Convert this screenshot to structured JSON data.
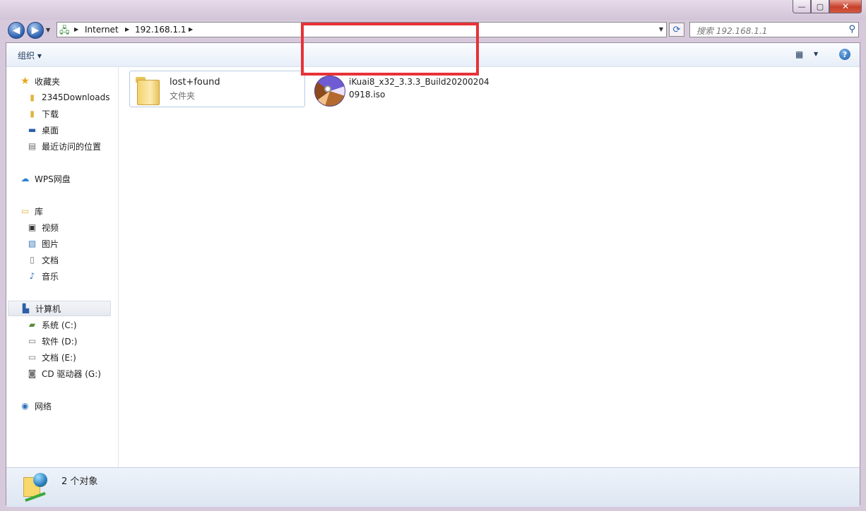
{
  "window": {
    "title": "",
    "controls": {
      "minimize": "—",
      "maximize": "▢",
      "close": "✕"
    }
  },
  "navigation": {
    "back": "◀",
    "forward": "▶",
    "breadcrumbs": [
      "Internet",
      "192.168.1.1"
    ],
    "search_placeholder": "搜索 192.168.1.1"
  },
  "toolbar": {
    "organize_label": "组织 ▾"
  },
  "sidebar": {
    "favorites": {
      "header": "收藏夹",
      "items": [
        "2345Downloads",
        "下载",
        "桌面",
        "最近访问的位置"
      ]
    },
    "wps": {
      "header": "WPS网盘"
    },
    "libraries": {
      "header": "库",
      "items": [
        "视频",
        "图片",
        "文档",
        "音乐"
      ]
    },
    "computer": {
      "header": "计算机",
      "items": [
        "系统 (C:)",
        "软件 (D:)",
        "文档 (E:)",
        "CD 驱动器 (G:)"
      ]
    },
    "network": {
      "header": "网络"
    }
  },
  "files": [
    {
      "name": "lost+found",
      "type": "文件夹",
      "icon": "folder-icon"
    },
    {
      "name": "iKuai8_x32_3.3.3_Build20200204 0918.iso",
      "type": "",
      "icon": "disc-image-icon"
    }
  ],
  "status": {
    "count_text": "2 个对象"
  },
  "colors": {
    "highlight": "#e63238",
    "accent": "#1e395b"
  }
}
